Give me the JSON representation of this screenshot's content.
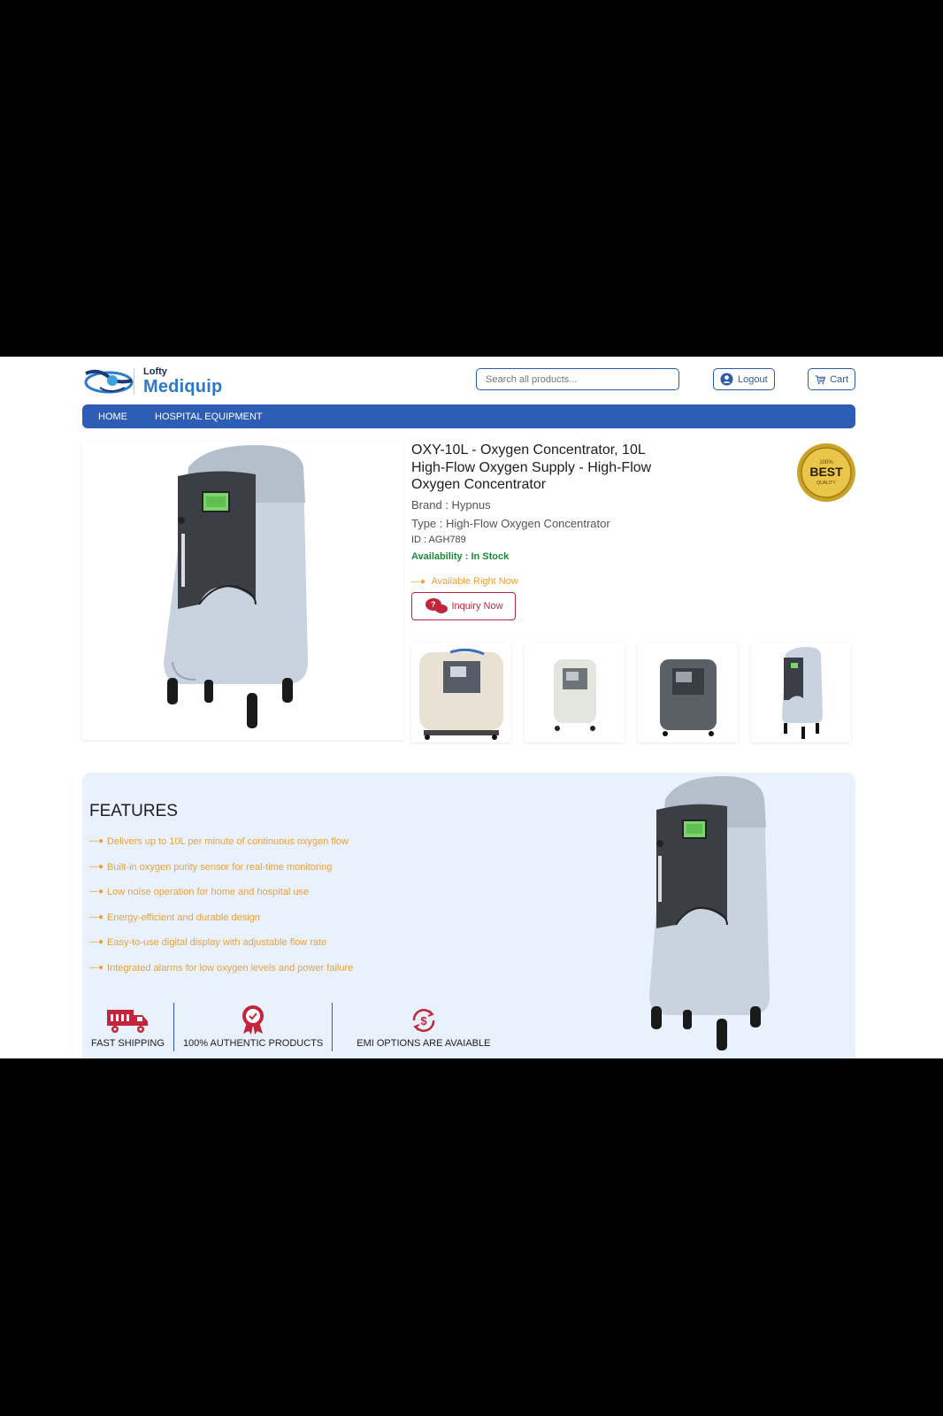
{
  "header": {
    "logo_small": "Lofty",
    "logo_big": "Mediquip",
    "search_placeholder": "Search all products...",
    "logout_label": "Logout",
    "cart_label": "Cart"
  },
  "nav": {
    "items": [
      "HOME",
      "HOSPITAL EQUIPMENT"
    ]
  },
  "product": {
    "title": "OXY-10L - Oxygen Concentrator, 10L High-Flow Oxygen Supply - High-Flow Oxygen Concentrator",
    "brand": "Brand : Hypnus",
    "type": "Type : High-Flow Oxygen Concentrator",
    "id": "ID : AGH789",
    "availability_label": "Availability : ",
    "availability_value": "In Stock",
    "right_now": "Available Right Now",
    "inquiry_label": "Inquiry Now",
    "badge_top": "100%",
    "badge_main": "BEST",
    "badge_bottom": "QUALITY"
  },
  "features": {
    "title": "FEATURES",
    "items": [
      "Delivers up to 10L per minute of continuous oxygen flow",
      "Built-in oxygen purity sensor for real-time monitoring",
      "Low noise operation for home and hospital use",
      "Energy-efficient and durable design",
      "Easy-to-use digital display with adjustable flow rate",
      "Integrated alarms for low oxygen levels and power failure"
    ],
    "badges": [
      "FAST SHIPPING",
      "100% AUTHENTIC PRODUCTS",
      "EMI OPTIONS ARE AVAIABLE"
    ]
  },
  "colors": {
    "brand_blue": "#2d5db5",
    "accent_orange": "#e9a23b",
    "accent_red": "#c3253b",
    "stock_green": "#1c8a3a",
    "features_bg": "#e9f1fd"
  },
  "icons": [
    "logo-mark",
    "user-icon",
    "cart-icon",
    "chat-icon",
    "truck-icon",
    "ribbon-icon",
    "dollar-refresh-icon"
  ]
}
